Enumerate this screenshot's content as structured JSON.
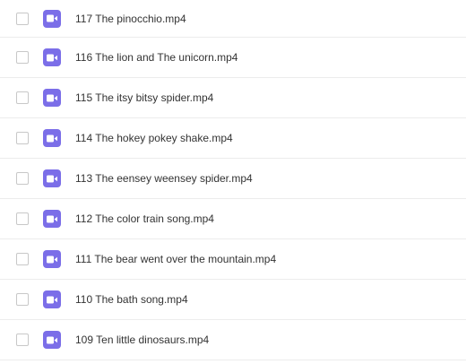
{
  "files": [
    {
      "name": "117 The pinocchio.mp4",
      "icon": "video-file-icon",
      "checked": false
    },
    {
      "name": "116 The lion and The unicorn.mp4",
      "icon": "video-file-icon",
      "checked": false
    },
    {
      "name": "115 The itsy bitsy spider.mp4",
      "icon": "video-file-icon",
      "checked": false
    },
    {
      "name": "114 The hokey pokey shake.mp4",
      "icon": "video-file-icon",
      "checked": false
    },
    {
      "name": "113 The eensey weensey spider.mp4",
      "icon": "video-file-icon",
      "checked": false
    },
    {
      "name": "112 The color train song.mp4",
      "icon": "video-file-icon",
      "checked": false
    },
    {
      "name": "111 The bear went over the mountain.mp4",
      "icon": "video-file-icon",
      "checked": false
    },
    {
      "name": "110 The bath song.mp4",
      "icon": "video-file-icon",
      "checked": false
    },
    {
      "name": "109 Ten little dinosaurs.mp4",
      "icon": "video-file-icon",
      "checked": false
    }
  ],
  "colors": {
    "icon_background": "#7b6ee8",
    "text": "#333333",
    "divider": "#ececec",
    "checkbox_border": "#c8c8c8"
  }
}
